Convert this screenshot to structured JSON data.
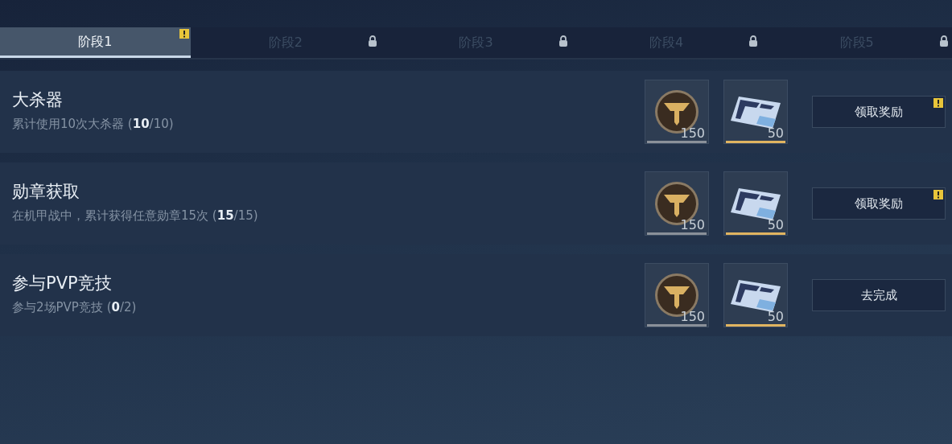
{
  "tabs": [
    {
      "label": "阶段1",
      "selected": true,
      "locked": false,
      "alert": true
    },
    {
      "label": "阶段2",
      "selected": false,
      "locked": true,
      "alert": false
    },
    {
      "label": "阶段3",
      "selected": false,
      "locked": true,
      "alert": false
    },
    {
      "label": "阶段4",
      "selected": false,
      "locked": true,
      "alert": false
    },
    {
      "label": "阶段5",
      "selected": false,
      "locked": true,
      "alert": false
    }
  ],
  "tasks": [
    {
      "title": "大杀器",
      "description": "累计使用10次大杀器 (**10**/10)",
      "rewards": [
        {
          "kind": "coin",
          "count": "150",
          "color": "#8a9099"
        },
        {
          "kind": "ticket",
          "count": "50",
          "color": "#e0b460"
        }
      ],
      "button": {
        "label": "领取奖励",
        "alert": true
      }
    },
    {
      "title": "勋章获取",
      "description": "在机甲战中，累计获得任意勋章15次 (**15**/15)",
      "rewards": [
        {
          "kind": "coin",
          "count": "150",
          "color": "#8a9099"
        },
        {
          "kind": "ticket",
          "count": "50",
          "color": "#e0b460"
        }
      ],
      "button": {
        "label": "领取奖励",
        "alert": true
      }
    },
    {
      "title": "参与PVP竞技",
      "description": "参与2场PVP竞技 (**0**/2)",
      "rewards": [
        {
          "kind": "coin",
          "count": "150",
          "color": "#8a9099"
        },
        {
          "kind": "ticket",
          "count": "50",
          "color": "#e0b460"
        }
      ],
      "button": {
        "label": "去完成",
        "alert": false
      }
    }
  ]
}
